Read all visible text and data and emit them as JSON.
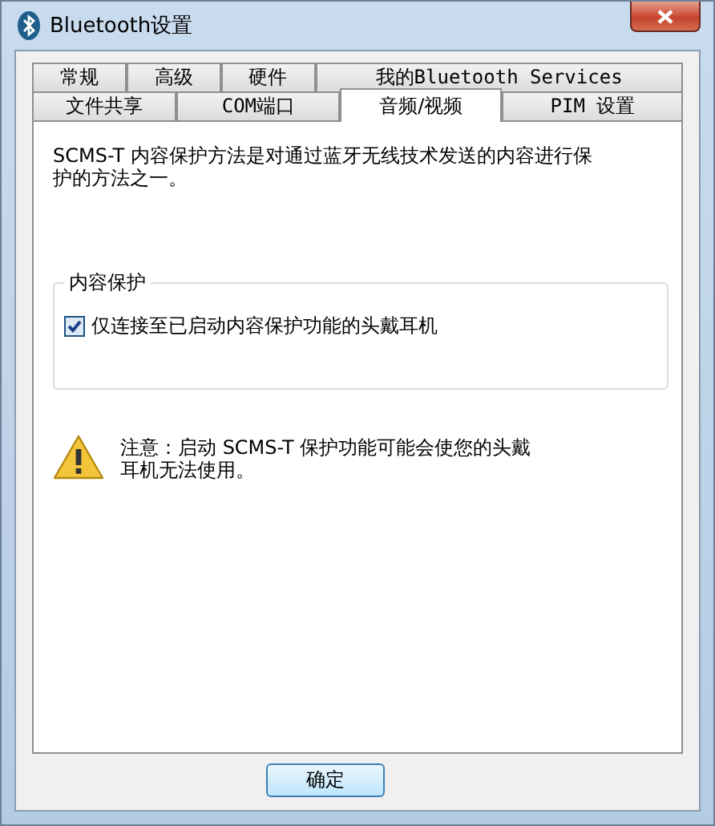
{
  "window": {
    "title": "Bluetooth设置"
  },
  "tab_rows": [
    [
      {
        "label": "常规",
        "selected": false
      },
      {
        "label": "高级",
        "selected": false
      },
      {
        "label": "硬件",
        "selected": false
      },
      {
        "label": "我的Bluetooth Services",
        "selected": false
      }
    ],
    [
      {
        "label": "文件共享",
        "selected": false
      },
      {
        "label": "COM端口",
        "selected": false
      },
      {
        "label": "音频/视频",
        "selected": true
      },
      {
        "label": "PIM 设置",
        "selected": false
      }
    ]
  ],
  "description": "SCMS-T 内容保护方法是对通过蓝牙无线技术发送的内容进行保护的方法之一。",
  "group": {
    "title": "内容保护",
    "checkbox": {
      "label": "仅连接至已启动内容保护功能的头戴耳机",
      "checked": true
    }
  },
  "warning": "注意：启动 SCMS-T 保护功能可能会使您的头戴耳机无法使用。",
  "buttons": [
    "确定"
  ]
}
